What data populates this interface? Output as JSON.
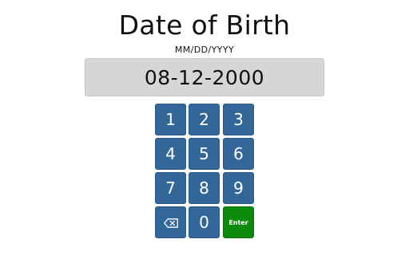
{
  "header": {
    "title": "Date of Birth",
    "format_hint": "MM/DD/YYYY"
  },
  "date_field": {
    "value": "08-12-2000"
  },
  "keypad": {
    "keys": [
      "1",
      "2",
      "3",
      "4",
      "5",
      "6",
      "7",
      "8",
      "9"
    ],
    "zero_label": "0",
    "enter_label": "Enter",
    "backspace_icon": "backspace-icon"
  },
  "colors": {
    "key_background": "#336699",
    "enter_background": "#0b8a0b",
    "display_background": "#d6d6d6"
  }
}
